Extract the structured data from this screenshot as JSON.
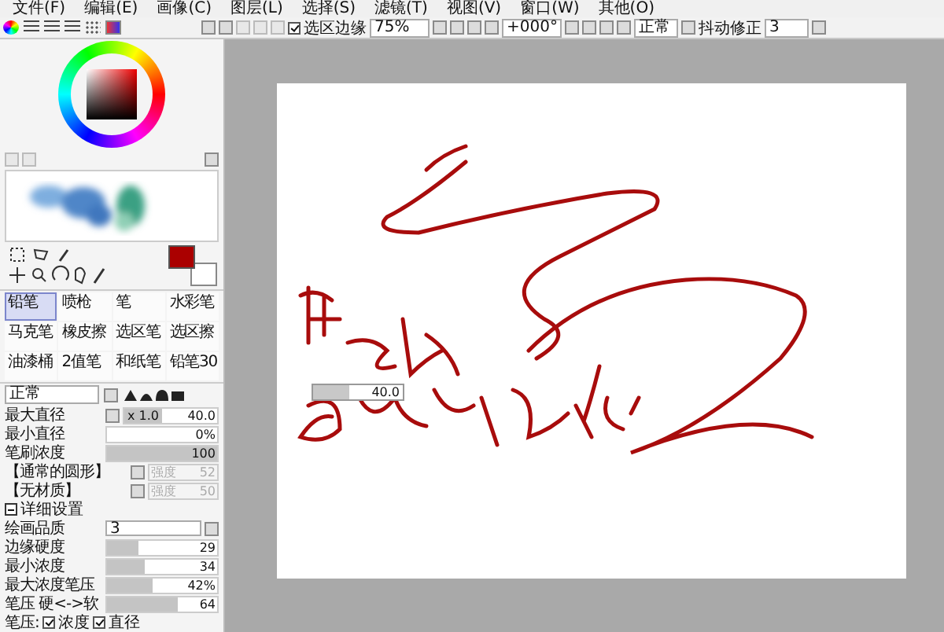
{
  "menu": [
    "文件(F)",
    "编辑(E)",
    "画像(C)",
    "图层(L)",
    "选择(S)",
    "滤镜(T)",
    "视图(V)",
    "窗口(W)",
    "其他(O)"
  ],
  "toolbar": {
    "selection_edge": {
      "label": "选区边缘",
      "checked": true
    },
    "zoom": "75%",
    "rotation": "+000°",
    "blend": "正常",
    "stabilizer_label": "抖动修正",
    "stabilizer": "3"
  },
  "tools": [
    {
      "name": "铅笔",
      "selected": true
    },
    {
      "name": "喷枪",
      "selected": false
    },
    {
      "name": "笔",
      "selected": false
    },
    {
      "name": "水彩笔",
      "selected": false
    },
    {
      "name": "马克笔",
      "selected": false
    },
    {
      "name": "橡皮擦",
      "selected": false
    },
    {
      "name": "选区笔",
      "selected": false
    },
    {
      "name": "选区擦",
      "selected": false
    },
    {
      "name": "油漆桶",
      "selected": false
    },
    {
      "name": "2值笔",
      "selected": false
    },
    {
      "name": "和纸笔",
      "selected": false
    },
    {
      "name": "铅笔30",
      "selected": false
    }
  ],
  "mode": "正常",
  "params": [
    {
      "kind": "slider",
      "label": "最大直径",
      "multiplier": "x 1.0",
      "value": "40.0",
      "level": 0.4
    },
    {
      "kind": "field",
      "label": "最小直径",
      "value": "0%"
    },
    {
      "kind": "slider",
      "label": "笔刷浓度",
      "value": "100",
      "level": 1
    },
    {
      "kind": "select",
      "label": "【通常的圆形】",
      "strength_label": "强度",
      "value": "52",
      "disabled": true
    },
    {
      "kind": "select",
      "label": "【无材质】",
      "strength_label": "强度",
      "value": "50",
      "disabled": true
    },
    {
      "kind": "section",
      "label": "详细设置",
      "expanded": true
    },
    {
      "kind": "dropdown",
      "label": "绘画品质",
      "value": "3"
    },
    {
      "kind": "slider",
      "label": "边缘硬度",
      "value": "29",
      "level": 0.29
    },
    {
      "kind": "slider",
      "label": "最小浓度",
      "value": "34",
      "level": 0.34
    },
    {
      "kind": "slider",
      "label": "最大浓度笔压",
      "value": "42%",
      "level": 0.42
    },
    {
      "kind": "slider",
      "label": "笔压 硬<->软",
      "value": "64",
      "level": 0.64
    },
    {
      "kind": "checks",
      "label": "笔压:",
      "items": [
        {
          "label": "浓度",
          "checked": true
        },
        {
          "label": "直径",
          "checked": true
        }
      ]
    }
  ],
  "size_popup": {
    "value": "40.0",
    "level": 0.4
  }
}
